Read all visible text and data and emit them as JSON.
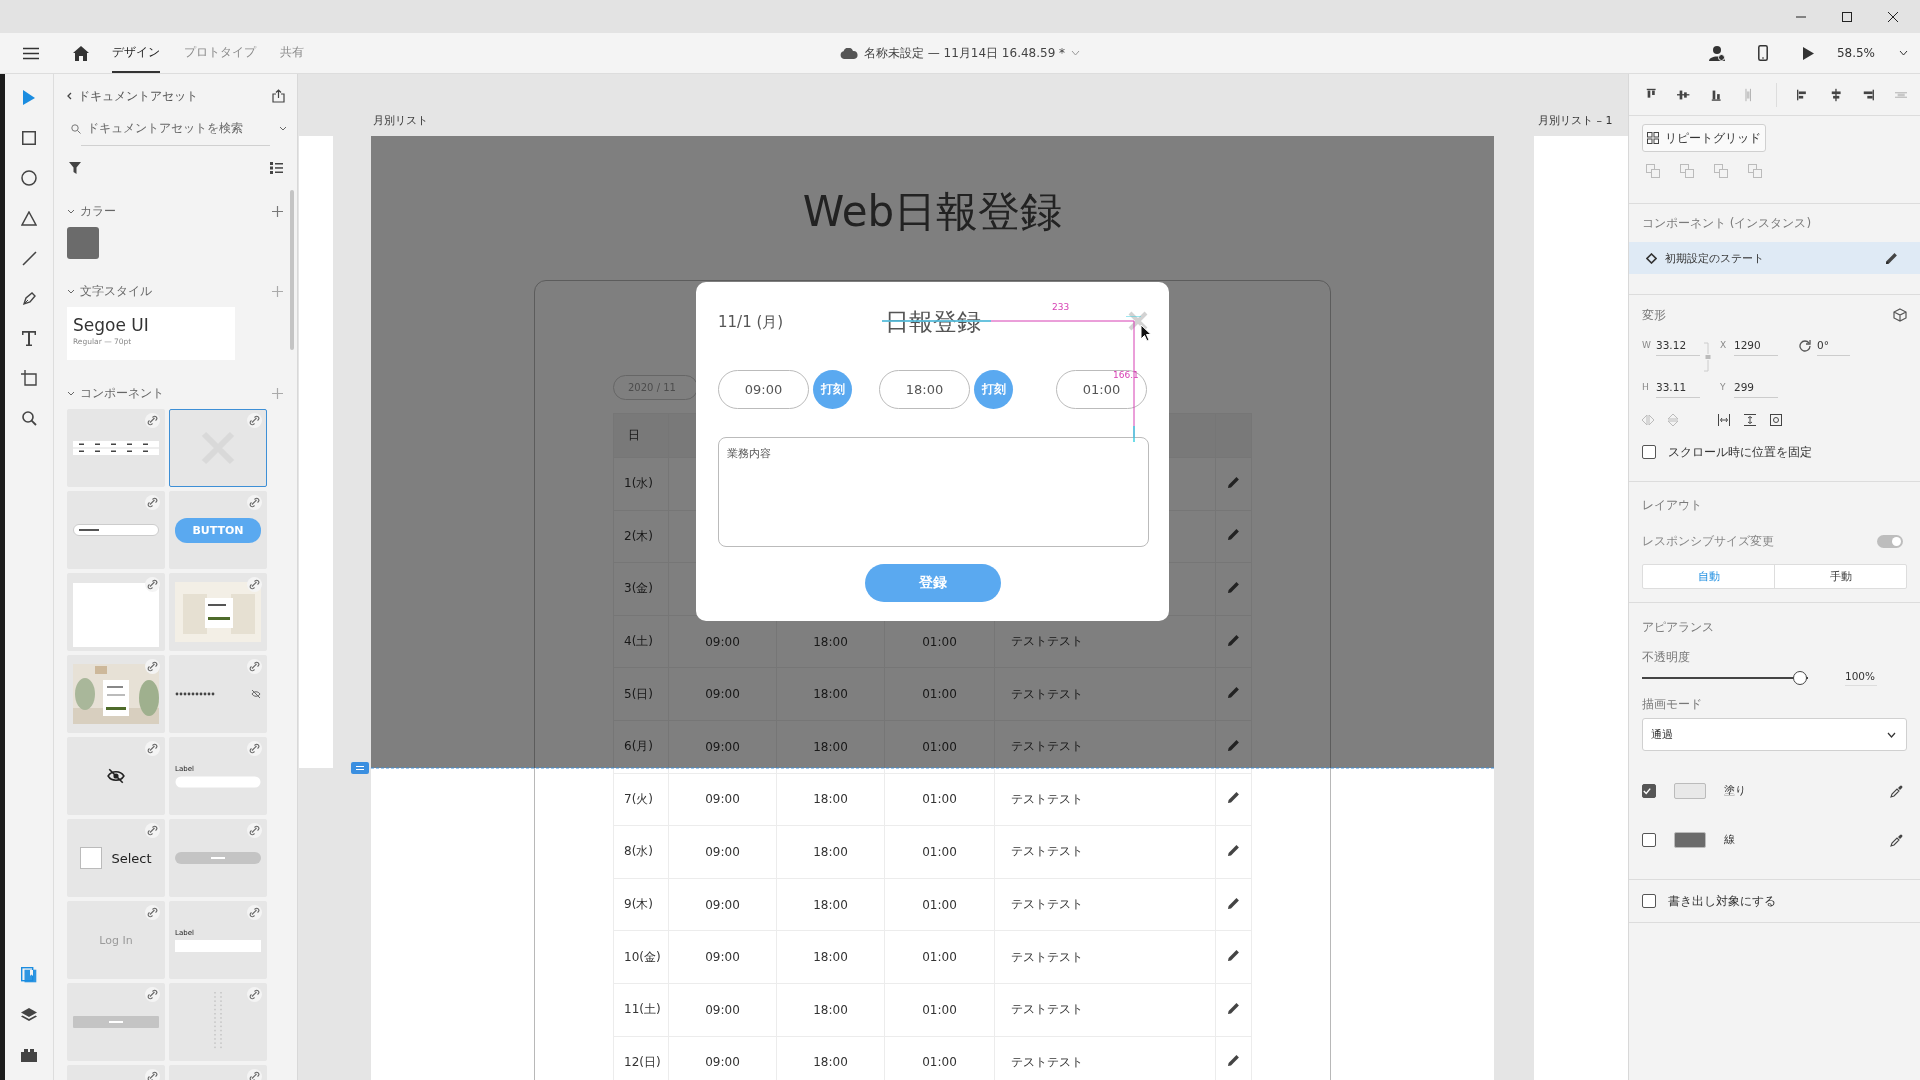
{
  "toolbar": {
    "tabs": [
      {
        "label": "デザイン",
        "selected": true
      },
      {
        "label": "プロトタイプ",
        "selected": false
      },
      {
        "label": "共有",
        "selected": false
      }
    ],
    "document_title": "名称未設定 — 11月14日 16.48.59 *",
    "zoom": "58.5%"
  },
  "tools": [
    {
      "kind": "select",
      "selected": true
    },
    {
      "kind": "rectangle",
      "selected": false
    },
    {
      "kind": "ellipse",
      "selected": false
    },
    {
      "kind": "polygon",
      "selected": false
    },
    {
      "kind": "line",
      "selected": false
    },
    {
      "kind": "pen",
      "selected": false
    },
    {
      "kind": "text",
      "selected": false
    },
    {
      "kind": "artboard",
      "selected": false
    },
    {
      "kind": "zoom",
      "selected": false
    }
  ],
  "panels": [
    {
      "kind": "assets",
      "selected": true
    },
    {
      "kind": "layers",
      "selected": false
    },
    {
      "kind": "plugins",
      "selected": false
    }
  ],
  "assets": {
    "title": "ドキュメントアセット",
    "search": {
      "placeholder": "ドキュメントアセットを検索"
    },
    "colors": {
      "title": "カラー",
      "swatches": [
        {
          "color": "#6b6b6b"
        }
      ]
    },
    "text_styles": {
      "title": "文字スタイル",
      "styles": [
        {
          "name": "Segoe UI",
          "detail": "Regular — 70pt"
        }
      ]
    },
    "components": {
      "title": "コンポーネント",
      "items": [
        {
          "kind": "table",
          "selected": false
        },
        {
          "kind": "missing",
          "selected": true
        },
        {
          "kind": "input",
          "selected": false
        },
        {
          "kind": "button",
          "text": "BUTTON",
          "selected": false
        },
        {
          "kind": "card",
          "selected": false
        },
        {
          "kind": "screen",
          "selected": false
        },
        {
          "kind": "picture",
          "selected": false
        },
        {
          "kind": "password",
          "selected": false
        },
        {
          "kind": "hidden-eye",
          "selected": false
        },
        {
          "kind": "labeled-input",
          "text": "Label",
          "selected": false
        },
        {
          "kind": "checkbox",
          "text": "Select",
          "selected": false
        },
        {
          "kind": "pill",
          "selected": false
        },
        {
          "kind": "text",
          "text": "Log In",
          "selected": false
        },
        {
          "kind": "labeled-box",
          "text": "Label",
          "selected": false
        },
        {
          "kind": "bar",
          "selected": false
        },
        {
          "kind": "column",
          "selected": false
        },
        {
          "kind": "blank",
          "selected": false
        },
        {
          "kind": "blank",
          "selected": false
        }
      ]
    }
  },
  "canvas": {
    "artboards": [
      {
        "label": "月別リスト"
      },
      {
        "label": "月別リスト – 1"
      }
    ],
    "page": {
      "title": "Web日報登録",
      "month": "2020 / 11",
      "columns": [
        "日"
      ],
      "rows": [
        {
          "day": "1(水)"
        },
        {
          "day": "2(木)"
        },
        {
          "day": "3(金)"
        },
        {
          "day": "4(土)",
          "start": "09:00",
          "end": "18:00",
          "break": "01:00",
          "note": "テストテスト"
        },
        {
          "day": "5(日)",
          "start": "09:00",
          "end": "18:00",
          "break": "01:00",
          "note": "テストテスト"
        },
        {
          "day": "6(月)",
          "start": "09:00",
          "end": "18:00",
          "break": "01:00",
          "note": "テストテスト"
        },
        {
          "day": "7(火)",
          "start": "09:00",
          "end": "18:00",
          "break": "01:00",
          "note": "テストテスト"
        },
        {
          "day": "8(水)",
          "start": "09:00",
          "end": "18:00",
          "break": "01:00",
          "note": "テストテスト"
        },
        {
          "day": "9(木)",
          "start": "09:00",
          "end": "18:00",
          "break": "01:00",
          "note": "テストテスト"
        },
        {
          "day": "10(金)",
          "start": "09:00",
          "end": "18:00",
          "break": "01:00",
          "note": "テストテスト"
        },
        {
          "day": "11(土)",
          "start": "09:00",
          "end": "18:00",
          "break": "01:00",
          "note": "テストテスト"
        },
        {
          "day": "12(日)",
          "start": "09:00",
          "end": "18:00",
          "break": "01:00",
          "note": "テストテスト"
        }
      ]
    },
    "dialog": {
      "date": "11/1 (月)",
      "title": "日報登録",
      "times": [
        {
          "value": "09:00",
          "stamp": "打刻"
        },
        {
          "value": "18:00",
          "stamp": "打刻"
        },
        {
          "value": "01:00"
        }
      ],
      "memo": {
        "placeholder": "業務内容"
      },
      "submit": "登録"
    },
    "measurements": [
      {
        "kind": "horizontal",
        "label": "233"
      },
      {
        "kind": "vertical",
        "label": "166.1"
      }
    ]
  },
  "properties": {
    "repeat_grid": "リピートグリッド",
    "component": {
      "title": "コンポーネント (インスタンス)",
      "state": "初期設定のステート"
    },
    "transform": {
      "title": "変形",
      "fields": [
        {
          "label": "W",
          "value": "33.12"
        },
        {
          "label": "X",
          "value": "1290"
        },
        {
          "label": "H",
          "value": "33.11"
        },
        {
          "label": "Y",
          "value": "299"
        }
      ],
      "rotation": "0°",
      "fix_on_scroll": {
        "label": "スクロール時に位置を固定",
        "checked": false
      }
    },
    "layout": {
      "title": "レイアウト",
      "responsive": {
        "label": "レスポンシブサイズ変更",
        "on": true
      },
      "modes": [
        {
          "label": "自動",
          "selected": true
        },
        {
          "label": "手動",
          "selected": false
        }
      ]
    },
    "appearance": {
      "title": "アピアランス",
      "opacity": {
        "label": "不透明度",
        "level": 1,
        "reading": "100%"
      },
      "blend": {
        "label": "描画モード",
        "value": "通過"
      },
      "paints": [
        {
          "label": "塗り",
          "checked": true,
          "color": "#e8e8e8"
        },
        {
          "label": "線",
          "checked": false,
          "color": "#6b6b6b"
        }
      ]
    },
    "export": {
      "label": "書き出し対象にする",
      "checked": false
    }
  }
}
